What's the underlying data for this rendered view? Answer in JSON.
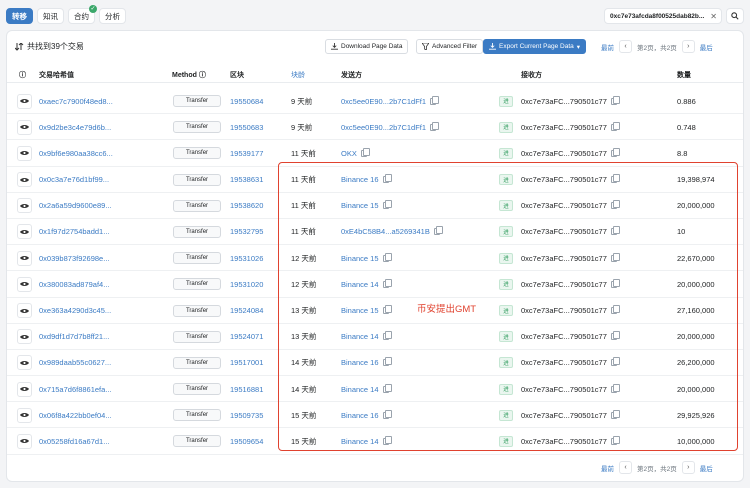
{
  "topbar": {
    "tabs": [
      {
        "label": "转移",
        "active": true
      },
      {
        "label": "知讯",
        "active": false
      },
      {
        "label": "合约",
        "active": false,
        "verified": true
      },
      {
        "label": "分析",
        "active": false
      }
    ],
    "address": "0xc7e73afcda8f00525dab82b..."
  },
  "header": {
    "count_text": "共找到39个交易",
    "download_label": "Download Page Data",
    "filter_label": "Advanced Filter",
    "export_label": "Export Current Page Data",
    "export_caret": "▾"
  },
  "pager": {
    "first": "最前",
    "prev": "‹",
    "page_text": "第2页，共2页",
    "next": "›",
    "last": "最后"
  },
  "columns": {
    "hash": "交易哈希值",
    "method": "Method",
    "block": "区块",
    "age": "块龄",
    "from": "发送方",
    "to": "接收方",
    "amount": "数量"
  },
  "rows": [
    {
      "hash": "0xaec7c7900f48ed8...",
      "method": "Transfer",
      "block": "19550684",
      "age": "9 天前",
      "from": "0xc5ee0E90...2b7C1dFf1",
      "dir": "进",
      "to": "0xc7e73aFC...790501c77",
      "amount": "0.886"
    },
    {
      "hash": "0x9d2be3c4e79d6b...",
      "method": "Transfer",
      "block": "19550683",
      "age": "9 天前",
      "from": "0xc5ee0E90...2b7C1dFf1",
      "dir": "进",
      "to": "0xc7e73aFC...790501c77",
      "amount": "0.748"
    },
    {
      "hash": "0x9bf6e980aa38cc6...",
      "method": "Transfer",
      "block": "19539177",
      "age": "11 天前",
      "from": "OKX",
      "dir": "进",
      "to": "0xc7e73aFC...790501c77",
      "amount": "8.8"
    },
    {
      "hash": "0x0c3a7e76d1bf99...",
      "method": "Transfer",
      "block": "19538631",
      "age": "11 天前",
      "from": "Binance 16",
      "dir": "进",
      "to": "0xc7e73aFC...790501c77",
      "amount": "19,398,974"
    },
    {
      "hash": "0x2a6a59d9600e89...",
      "method": "Transfer",
      "block": "19538620",
      "age": "11 天前",
      "from": "Binance 15",
      "dir": "进",
      "to": "0xc7e73aFC...790501c77",
      "amount": "20,000,000"
    },
    {
      "hash": "0x1f97d2754badd1...",
      "method": "Transfer",
      "block": "19532795",
      "age": "11 天前",
      "from": "0xE4bC58B4...a5269341B",
      "dir": "进",
      "to": "0xc7e73aFC...790501c77",
      "amount": "10"
    },
    {
      "hash": "0x039b873f92698e...",
      "method": "Transfer",
      "block": "19531026",
      "age": "12 天前",
      "from": "Binance 15",
      "dir": "进",
      "to": "0xc7e73aFC...790501c77",
      "amount": "22,670,000"
    },
    {
      "hash": "0x380083ad879af4...",
      "method": "Transfer",
      "block": "19531020",
      "age": "12 天前",
      "from": "Binance 14",
      "dir": "进",
      "to": "0xc7e73aFC...790501c77",
      "amount": "20,000,000"
    },
    {
      "hash": "0xe363a4290d3c45...",
      "method": "Transfer",
      "block": "19524084",
      "age": "13 天前",
      "from": "Binance 15",
      "dir": "进",
      "to": "0xc7e73aFC...790501c77",
      "amount": "27,160,000"
    },
    {
      "hash": "0xd9df1d7d7b8ff21...",
      "method": "Transfer",
      "block": "19524071",
      "age": "13 天前",
      "from": "Binance 14",
      "dir": "进",
      "to": "0xc7e73aFC...790501c77",
      "amount": "20,000,000"
    },
    {
      "hash": "0x989daab55c0627...",
      "method": "Transfer",
      "block": "19517001",
      "age": "14 天前",
      "from": "Binance 16",
      "dir": "进",
      "to": "0xc7e73aFC...790501c77",
      "amount": "26,200,000"
    },
    {
      "hash": "0x715a7d6f8861efa...",
      "method": "Transfer",
      "block": "19516881",
      "age": "14 天前",
      "from": "Binance 14",
      "dir": "进",
      "to": "0xc7e73aFC...790501c77",
      "amount": "20,000,000"
    },
    {
      "hash": "0x06f8a422bb0ef04...",
      "method": "Transfer",
      "block": "19509735",
      "age": "15 天前",
      "from": "Binance 16",
      "dir": "进",
      "to": "0xc7e73aFC...790501c77",
      "amount": "29,925,926"
    },
    {
      "hash": "0x05258fd16a67d1...",
      "method": "Transfer",
      "block": "19509654",
      "age": "15 天前",
      "from": "Binance 14",
      "dir": "进",
      "to": "0xc7e73aFC...790501c77",
      "amount": "10,000,000"
    }
  ],
  "annotation": "币安提出GMT",
  "colors": {
    "accent": "#3b7bc4",
    "highlight": "#e0422f",
    "in_badge": "#2d9a5b"
  }
}
